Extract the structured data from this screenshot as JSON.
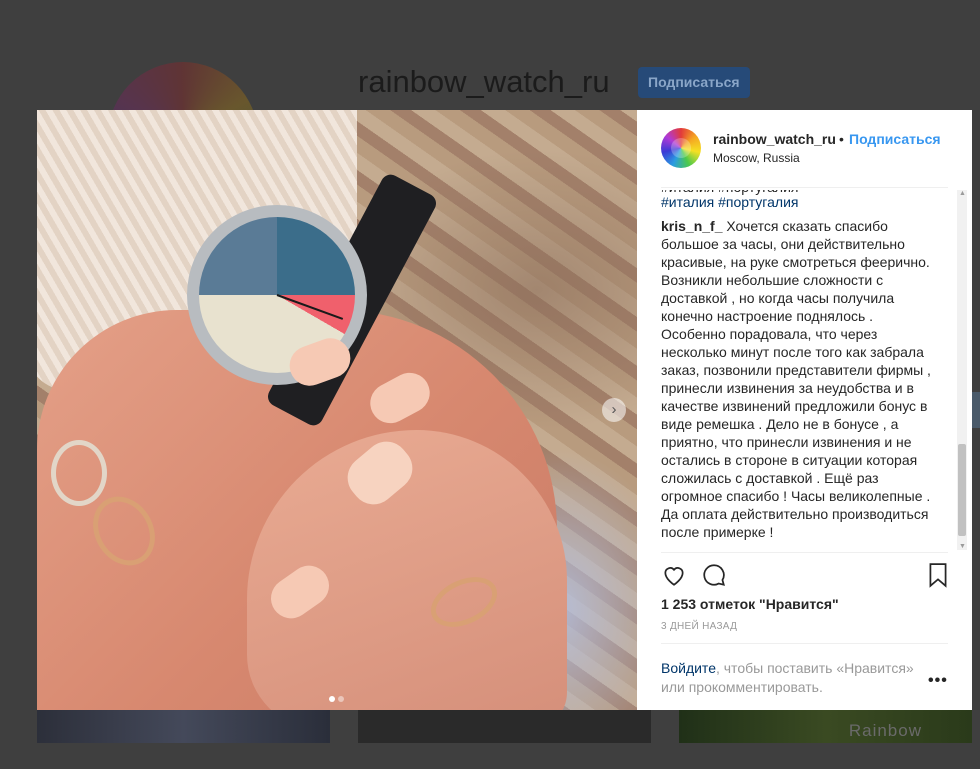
{
  "background": {
    "username": "rainbow_watch_ru",
    "follow_label": "Подписаться",
    "thumb_caption": "Rainbow"
  },
  "photo": {
    "next_icon": "chevron-right-icon",
    "carousel_total": 2,
    "carousel_active": 1
  },
  "post_header": {
    "username": "rainbow_watch_ru",
    "separator": "•",
    "follow_label": "Подписаться",
    "location": "Moscow, Russia"
  },
  "comments": {
    "hashtags": "#италия #португалия",
    "items": [
      {
        "username": "kris_n_f_",
        "text": "Хочется сказать спасибо большое за часы, они действительно красивые, на руке смотреться феерично. Возникли небольшие сложности с доставкой , но когда часы получила конечно настроение поднялось . Особенно порадовала, что через несколько минут после того как забрала заказ, позвонили представители фирмы , принесли извинения за неудобства и в качестве извинений предложили бонус в виде ремешка . Дело не в бонусе , а приятно, что принесли извинения и не остались в стороне в ситуации которая сложилась с доставкой . Ещё раз огромное спасибо ! Часы великолепные . Да оплата действительно производиться после примерке !"
      }
    ]
  },
  "actions": {
    "like_icon": "heart-icon",
    "comment_icon": "comment-bubble-icon",
    "save_icon": "bookmark-icon"
  },
  "likes_text": "1 253 отметок \"Нравится\"",
  "timestamp": "3 ДНЕЙ НАЗАД",
  "login_prompt": {
    "link": "Войдите",
    "rest": ", чтобы поставить «Нравится» или прокомментировать."
  },
  "more_label": "•••",
  "colors": {
    "link_blue": "#3897f0",
    "text": "#262626",
    "muted": "#999999",
    "hashtag": "#003569"
  }
}
